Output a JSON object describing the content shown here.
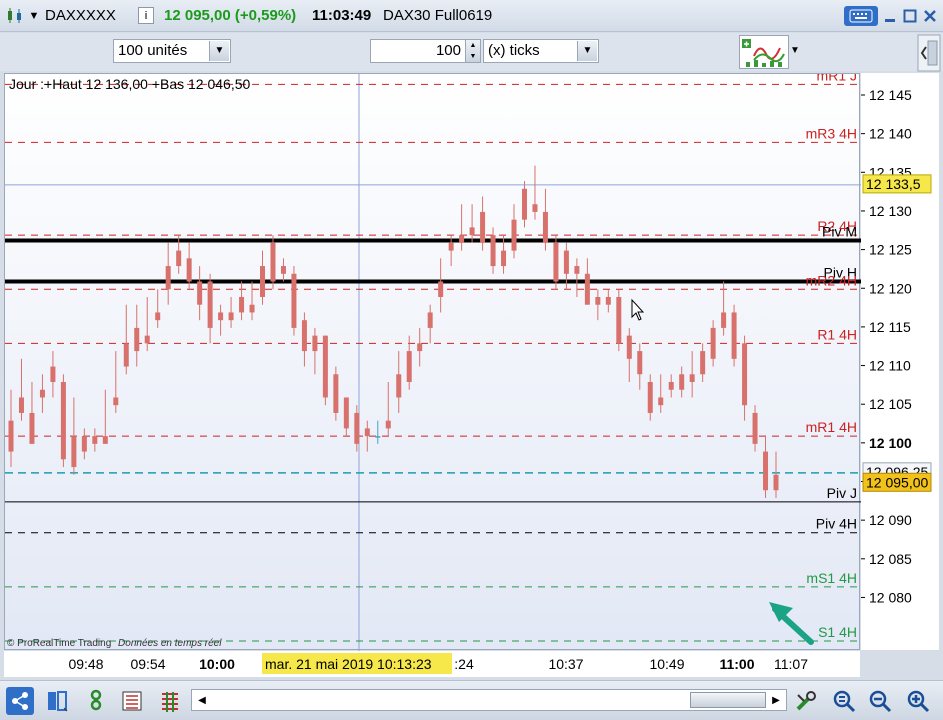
{
  "window": {
    "symbol": "DAXXXXX",
    "price_change": "12 095,00 (+0,59%)",
    "time": "11:03:49",
    "instrument": "DAX30 Full0619"
  },
  "toolbar": {
    "units_select": "100 unités",
    "ticks_value": "100",
    "ticks_unit_select": "(x) ticks"
  },
  "chart": {
    "info": "Jour :+Haut 12 136,00 +Bas 12 046,50",
    "watermark": "© ProRealTime Trading",
    "watermark_note": "Données en temps réel",
    "crosshair_label": "mar. 21 mai 2019 10:13:23",
    "colors": {
      "up": "#4a9fc8",
      "down": "#d8716c",
      "resistance": "#cc2222",
      "support": "#229944",
      "pivot": "#000000",
      "current": "#1a9fb0",
      "arrow": "#1aa385"
    },
    "levels": [
      {
        "label": "mR1 J",
        "price": 12146.5,
        "kind": "resistance"
      },
      {
        "label": "mR3 4H",
        "price": 12139,
        "kind": "resistance"
      },
      {
        "label": "R2 4H",
        "price": 12127,
        "kind": "resistance"
      },
      {
        "label": "Piv M",
        "price": 12126.3,
        "kind": "pivot-thick"
      },
      {
        "label": "Piv H",
        "price": 12121,
        "kind": "pivot-thick"
      },
      {
        "label": "mR2 4H",
        "price": 12120,
        "kind": "resistance"
      },
      {
        "label": "R1 4H",
        "price": 12113,
        "kind": "resistance"
      },
      {
        "label": "mR1 4H",
        "price": 12101,
        "kind": "resistance"
      },
      {
        "label": "Piv J",
        "price": 12092.5,
        "kind": "pivot-thin"
      },
      {
        "label": "Piv 4H",
        "price": 12088.5,
        "kind": "pivot-dash"
      },
      {
        "label": "mS1 4H",
        "price": 12081.5,
        "kind": "support"
      },
      {
        "label": "S1 4H",
        "price": 12074.5,
        "kind": "support"
      }
    ],
    "price_axis": {
      "ticks": [
        "12 145",
        "12 140",
        "12 135",
        "12 130",
        "12 125",
        "12 120",
        "12 115",
        "12 110",
        "12 105",
        "12 100",
        "12 095",
        "12 090",
        "12 085",
        "12 080"
      ],
      "cursor_price_label": "12 133,5",
      "ref_price_label": "12 096,25",
      "last_price_label": "12 095,00"
    },
    "time_axis": {
      "ticks": [
        "09:48",
        "09:54",
        "10:00",
        ":24",
        "10:37",
        "10:49",
        "11:00",
        "11:07"
      ]
    },
    "candles": [
      [
        12103,
        12107,
        12099,
        12097
      ],
      [
        12106,
        12111,
        12104,
        12103
      ],
      [
        12104,
        12108,
        12100,
        12100
      ],
      [
        12107,
        12109,
        12106,
        12104
      ],
      [
        12110,
        12112,
        12108,
        12106
      ],
      [
        12108,
        12109,
        12098,
        12097
      ],
      [
        12101,
        12106,
        12097,
        12096
      ],
      [
        12101,
        12102,
        12099,
        12098
      ],
      [
        12101,
        12102,
        12100,
        12099
      ],
      [
        12101,
        12107,
        12100,
        12100
      ],
      [
        12106,
        12112,
        12105,
        12104
      ],
      [
        12113,
        12118,
        12110,
        12109
      ],
      [
        12115,
        12118,
        12112,
        12110
      ],
      [
        12114,
        12119,
        12113,
        12112
      ],
      [
        12117,
        12120,
        12116,
        12115
      ],
      [
        12123,
        12126,
        12120,
        12118
      ],
      [
        12125,
        12127,
        12123,
        12122
      ],
      [
        12124,
        12126,
        12121,
        12120
      ],
      [
        12121,
        12123,
        12118,
        12116
      ],
      [
        12121,
        12122,
        12115,
        12113
      ],
      [
        12117,
        12118,
        12116,
        12114
      ],
      [
        12117,
        12119,
        12116,
        12115
      ],
      [
        12119,
        12121,
        12117,
        12116
      ],
      [
        12118,
        12121,
        12117,
        12116
      ],
      [
        12123,
        12125,
        12119,
        12118
      ],
      [
        12126,
        12127,
        12121,
        12120
      ],
      [
        12123,
        12124,
        12122,
        12121
      ],
      [
        12122,
        12123,
        12115,
        12114
      ],
      [
        12116,
        12117,
        12112,
        12110
      ],
      [
        12114,
        12115,
        12112,
        12109
      ],
      [
        12114,
        12114,
        12106,
        12105
      ],
      [
        12109,
        12110,
        12104,
        12103
      ],
      [
        12106,
        12106,
        12102,
        12101
      ],
      [
        12104,
        12105,
        12100,
        12099
      ],
      [
        12102,
        12103,
        12101,
        12099
      ],
      [
        12101,
        12103,
        12101,
        12100
      ],
      [
        12103,
        12108,
        12102,
        12101
      ],
      [
        12109,
        12112,
        12106,
        12104
      ],
      [
        12112,
        12114,
        12108,
        12107
      ],
      [
        12113,
        12115,
        12112,
        12110
      ],
      [
        12117,
        12118,
        12115,
        12113
      ],
      [
        12121,
        12124,
        12119,
        12117
      ],
      [
        12126,
        12127,
        12125,
        12123
      ],
      [
        12127,
        12131,
        12126,
        12125
      ],
      [
        12128,
        12131,
        12127,
        12126
      ],
      [
        12130,
        12132,
        12126,
        12125
      ],
      [
        12127,
        12128,
        12123,
        12122
      ],
      [
        12125,
        12127,
        12123,
        12122
      ],
      [
        12129,
        12131,
        12125,
        12124
      ],
      [
        12133,
        12134,
        12129,
        12128
      ],
      [
        12131,
        12136,
        12130,
        12129
      ],
      [
        12130,
        12133,
        12126,
        12125
      ],
      [
        12126,
        12127,
        12121,
        12120
      ],
      [
        12125,
        12126,
        12122,
        12120
      ],
      [
        12123,
        12124,
        12122,
        12119
      ],
      [
        12122,
        12124,
        12118,
        12118
      ],
      [
        12119,
        12120,
        12118,
        12116
      ],
      [
        12119,
        12120,
        12118,
        12117
      ],
      [
        12119,
        12120,
        12113,
        12112
      ],
      [
        12114,
        12115,
        12111,
        12108
      ],
      [
        12112,
        12113,
        12109,
        12107
      ],
      [
        12108,
        12109,
        12104,
        12103
      ],
      [
        12106,
        12109,
        12105,
        12104
      ],
      [
        12108,
        12109,
        12107,
        12106
      ],
      [
        12109,
        12110,
        12107,
        12106
      ],
      [
        12109,
        12112,
        12108,
        12106
      ],
      [
        12112,
        12113,
        12109,
        12108
      ],
      [
        12115,
        12116,
        12111,
        12110
      ],
      [
        12117,
        12121,
        12115,
        12114
      ],
      [
        12117,
        12118,
        12111,
        12110
      ],
      [
        12113,
        12114,
        12105,
        12103
      ],
      [
        12104,
        12105,
        12100,
        12099
      ],
      [
        12099,
        12101,
        12094,
        12093
      ],
      [
        12096,
        12099,
        12094,
        12093
      ]
    ]
  },
  "bottombar": {
    "buttons": [
      "share-icon",
      "layout-icon",
      "link-icon",
      "list-icon",
      "indicator-icon",
      "scroll-left-icon",
      "scroll-right-icon",
      "tools-icon",
      "zoom-fit-icon",
      "zoom-out-icon",
      "zoom-in-icon"
    ]
  }
}
